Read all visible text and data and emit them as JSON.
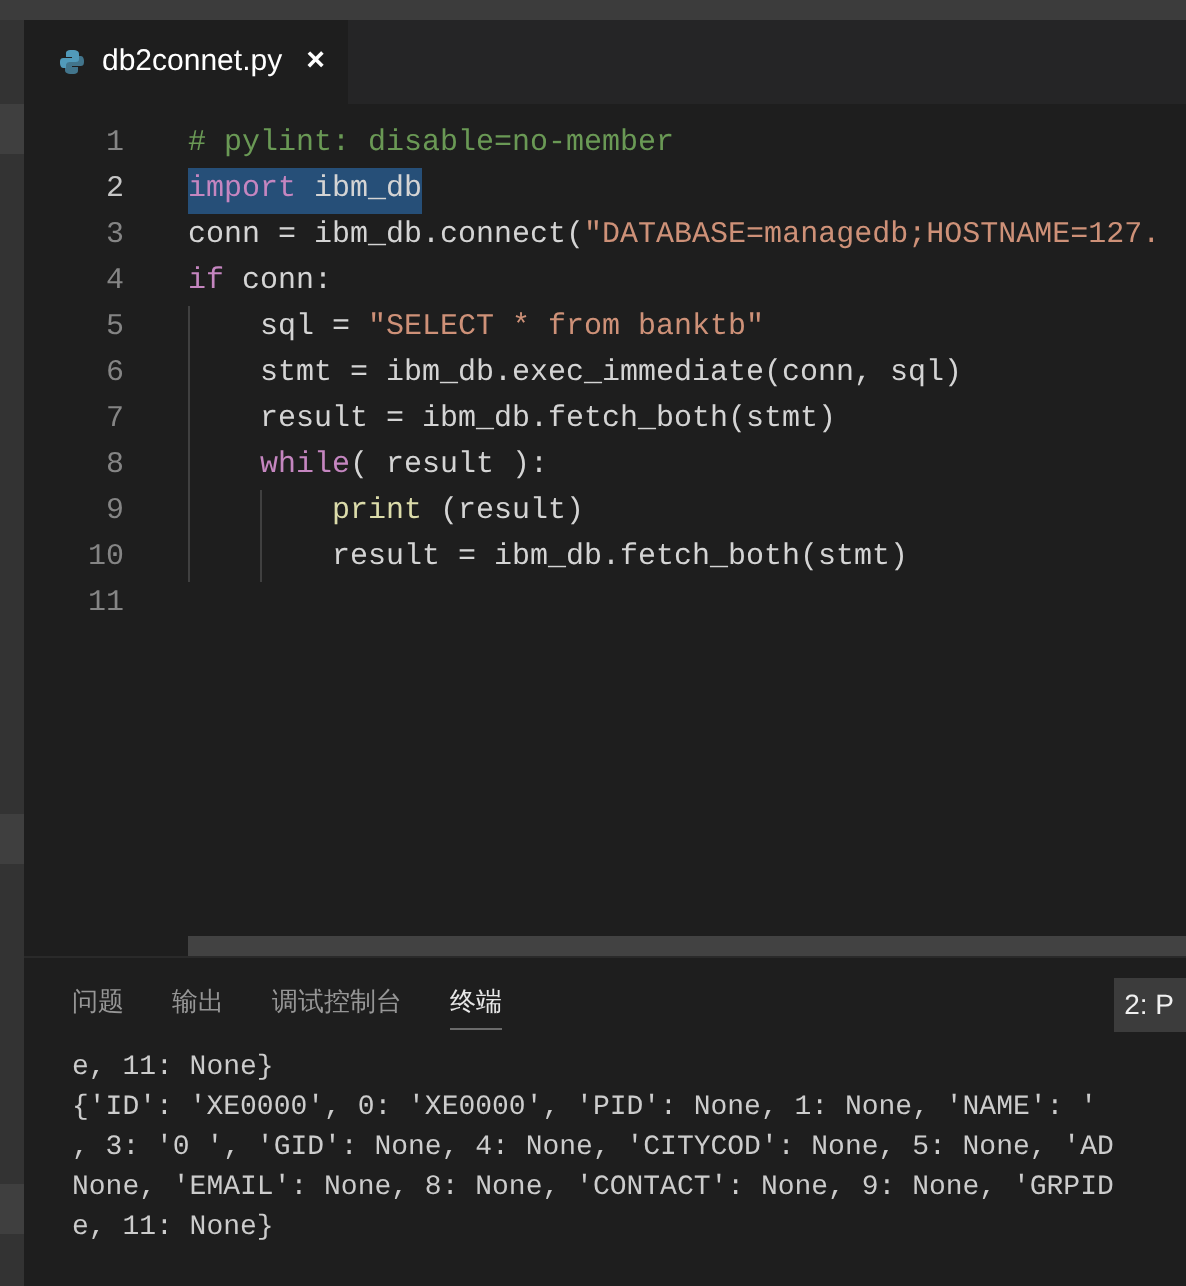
{
  "tab": {
    "filename": "db2connet.py",
    "close": "×",
    "selected": true
  },
  "code_lines": [
    {
      "number": "1",
      "selected": false,
      "tokens": [
        {
          "text": "# pylint: disable=no-member",
          "kind": "comment"
        }
      ]
    },
    {
      "number": "2",
      "selected": true,
      "tokens": [
        {
          "text": "import",
          "kind": "keyword"
        },
        {
          "text": " ibm_db",
          "kind": "plain"
        }
      ]
    },
    {
      "number": "3",
      "selected": false,
      "tokens": [
        {
          "text": "conn = ibm_db.connect(",
          "kind": "plain"
        },
        {
          "text": "\"DATABASE=managedb;HOSTNAME=127.",
          "kind": "string"
        }
      ]
    },
    {
      "number": "4",
      "selected": false,
      "tokens": [
        {
          "text": "if",
          "kind": "keyword"
        },
        {
          "text": " conn:",
          "kind": "plain"
        }
      ]
    },
    {
      "number": "5",
      "selected": false,
      "tokens": [
        {
          "text": "    sql = ",
          "kind": "plain"
        },
        {
          "text": "\"SELECT * from banktb\"",
          "kind": "string"
        }
      ]
    },
    {
      "number": "6",
      "selected": false,
      "tokens": [
        {
          "text": "    stmt = ibm_db.exec_immediate(conn, sql)",
          "kind": "plain"
        }
      ]
    },
    {
      "number": "7",
      "selected": false,
      "tokens": [
        {
          "text": "    result = ibm_db.fetch_both(stmt)",
          "kind": "plain"
        }
      ]
    },
    {
      "number": "8",
      "selected": false,
      "tokens": [
        {
          "text": "    while",
          "kind": "keyword"
        },
        {
          "text": "( result ):",
          "kind": "plain"
        }
      ]
    },
    {
      "number": "9",
      "selected": false,
      "tokens": [
        {
          "text": "        print",
          "kind": "function"
        },
        {
          "text": " (result)",
          "kind": "plain"
        }
      ]
    },
    {
      "number": "10",
      "selected": false,
      "tokens": [
        {
          "text": "        result = ibm_db.fetch_both(stmt)",
          "kind": "plain"
        }
      ]
    },
    {
      "number": "11",
      "selected": false
    }
  ],
  "panel": {
    "tabs": [
      {
        "label": "问题",
        "selected": false
      },
      {
        "label": "输出",
        "selected": false
      },
      {
        "label": "调试控制台",
        "selected": false
      },
      {
        "label": "终端",
        "selected": true
      }
    ],
    "terminal_select": "2: P",
    "terminal_lines": [
      "e, 11: None}",
      "{'ID': 'XE0000', 0: 'XE0000', 'PID': None, 1: None, 'NAME': '",
      ", 3: '0 ', 'GID': None, 4: None, 'CITYCOD': None, 5: None, 'AD",
      "None, 'EMAIL': None, 8: None, 'CONTACT': None, 9: None, 'GRPID",
      "e, 11: None}"
    ]
  }
}
